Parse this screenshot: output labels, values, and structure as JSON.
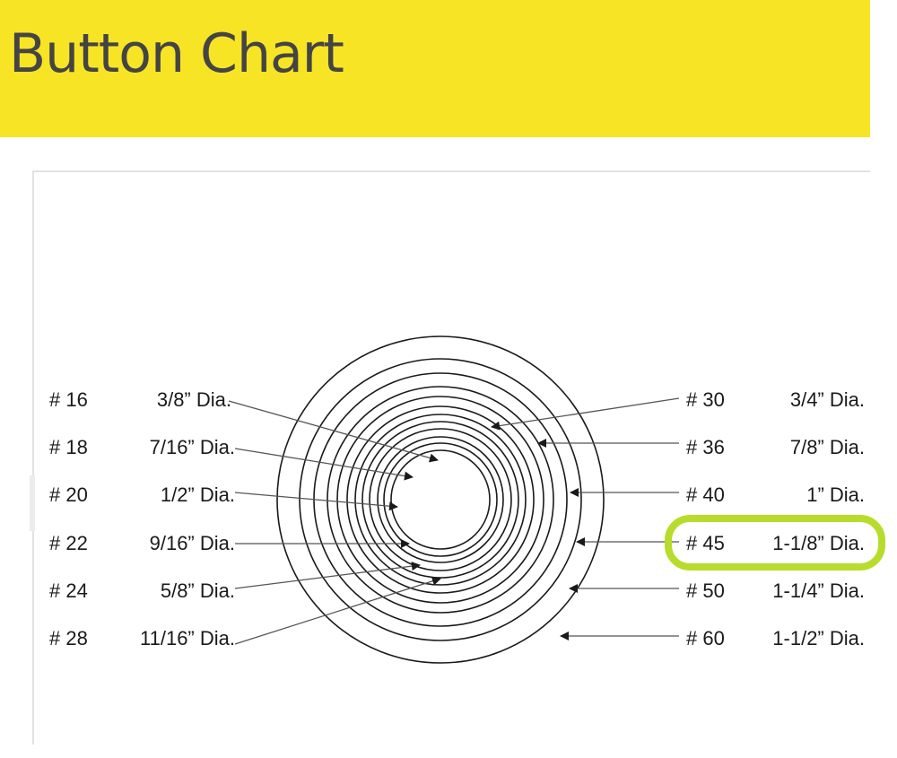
{
  "header": {
    "title": "Button Chart"
  },
  "colors": {
    "header_bg": "#f7e425",
    "highlight": "#b8dc2c"
  },
  "buttons_left": [
    {
      "size": "# 16",
      "diameter": "3/8” Dia."
    },
    {
      "size": "# 18",
      "diameter": "7/16” Dia."
    },
    {
      "size": "# 20",
      "diameter": "1/2” Dia."
    },
    {
      "size": "# 22",
      "diameter": "9/16” Dia."
    },
    {
      "size": "# 24",
      "diameter": "5/8” Dia."
    },
    {
      "size": "# 28",
      "diameter": "11/16” Dia."
    }
  ],
  "buttons_right": [
    {
      "size": "# 30",
      "diameter": "3/4” Dia."
    },
    {
      "size": "# 36",
      "diameter": "7/8” Dia."
    },
    {
      "size": "# 40",
      "diameter": "1” Dia."
    },
    {
      "size": "# 45",
      "diameter": "1-1/8” Dia.",
      "highlighted": true
    },
    {
      "size": "# 50",
      "diameter": "1-1/4” Dia."
    },
    {
      "size": "# 60",
      "diameter": "1-1/2” Dia."
    }
  ]
}
